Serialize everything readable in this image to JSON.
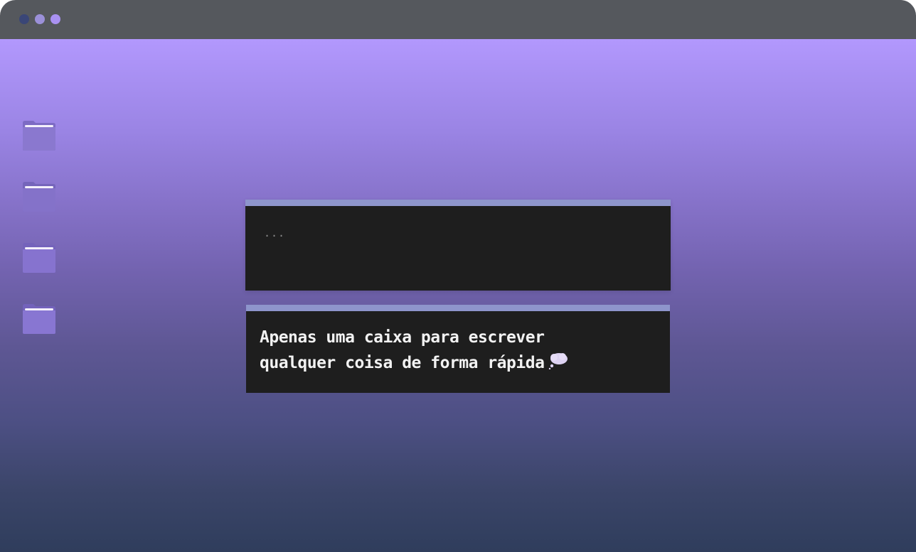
{
  "window": {
    "controls": [
      "close",
      "minimize",
      "maximize"
    ],
    "control_colors": [
      "#3a4677",
      "#9b90d9",
      "#a991f2"
    ]
  },
  "desktop": {
    "folders": [
      {
        "icon": "folder-icon"
      },
      {
        "icon": "folder-icon"
      },
      {
        "icon": "folder-icon"
      },
      {
        "icon": "folder-icon"
      }
    ]
  },
  "notes": {
    "input_placeholder": "...",
    "note_line_1": "Apenas uma caixa para escrever",
    "note_line_2": "qualquer coisa de forma rápida",
    "note_icon": "thought-bubble-icon"
  },
  "colors": {
    "titlebar": "#55585d",
    "accent": "#8e95cc",
    "box_bg": "#1e1e1e"
  }
}
